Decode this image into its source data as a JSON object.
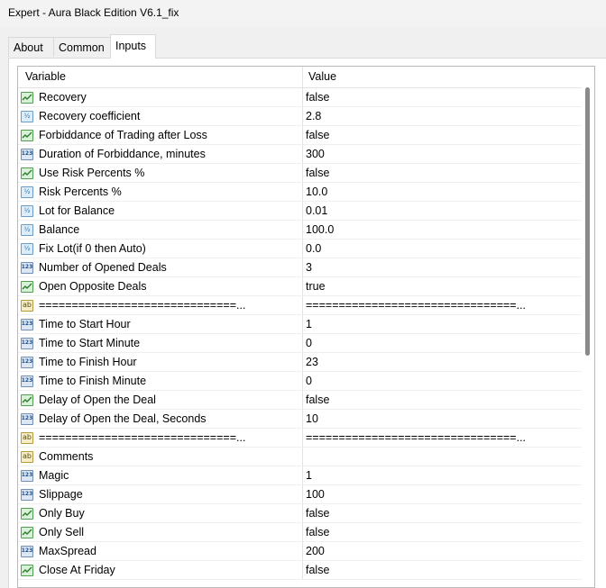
{
  "window": {
    "title": "Expert - Aura Black Edition V6.1_fix"
  },
  "tabs": [
    {
      "label": "About"
    },
    {
      "label": "Common"
    },
    {
      "label": "Inputs",
      "active": true
    }
  ],
  "table": {
    "columns": {
      "variable": "Variable",
      "value": "Value"
    },
    "rows": [
      {
        "type": "bool",
        "icon": "bool-icon",
        "name": "Recovery",
        "value": "false"
      },
      {
        "type": "dbl",
        "icon": "double-icon",
        "name": "Recovery coefficient",
        "value": "2.8"
      },
      {
        "type": "bool",
        "icon": "bool-icon",
        "name": "Forbiddance of Trading after Loss",
        "value": "false"
      },
      {
        "type": "int",
        "icon": "int-icon",
        "name": "Duration of Forbiddance, minutes",
        "value": "300"
      },
      {
        "type": "bool",
        "icon": "bool-icon",
        "name": "Use Risk Percents %",
        "value": "false"
      },
      {
        "type": "dbl",
        "icon": "double-icon",
        "name": "Risk Percents %",
        "value": "10.0"
      },
      {
        "type": "dbl",
        "icon": "double-icon",
        "name": "Lot for Balance",
        "value": "0.01"
      },
      {
        "type": "dbl",
        "icon": "double-icon",
        "name": "Balance",
        "value": "100.0"
      },
      {
        "type": "dbl",
        "icon": "double-icon",
        "name": "Fix Lot(if 0 then Auto)",
        "value": "0.0"
      },
      {
        "type": "int",
        "icon": "int-icon",
        "name": "Number of Opened Deals",
        "value": "3"
      },
      {
        "type": "bool",
        "icon": "bool-icon",
        "name": "Open Opposite Deals",
        "value": "true"
      },
      {
        "type": "str",
        "icon": "string-icon",
        "name": "==============================...",
        "value": "================================..."
      },
      {
        "type": "int",
        "icon": "int-icon",
        "name": "Time to Start Hour",
        "value": "1"
      },
      {
        "type": "int",
        "icon": "int-icon",
        "name": "Time to Start Minute",
        "value": "0"
      },
      {
        "type": "int",
        "icon": "int-icon",
        "name": "Time to Finish Hour",
        "value": "23"
      },
      {
        "type": "int",
        "icon": "int-icon",
        "name": "Time to Finish Minute",
        "value": "0"
      },
      {
        "type": "bool",
        "icon": "bool-icon",
        "name": "Delay of Open the Deal",
        "value": "false"
      },
      {
        "type": "int",
        "icon": "int-icon",
        "name": "Delay of Open the Deal, Seconds",
        "value": "10"
      },
      {
        "type": "str",
        "icon": "string-icon",
        "name": "==============================...",
        "value": "================================..."
      },
      {
        "type": "str",
        "icon": "string-icon",
        "name": "Comments",
        "value": ""
      },
      {
        "type": "int",
        "icon": "int-icon",
        "name": "Magic",
        "value": "1"
      },
      {
        "type": "int",
        "icon": "int-icon",
        "name": "Slippage",
        "value": "100"
      },
      {
        "type": "bool",
        "icon": "bool-icon",
        "name": "Only Buy",
        "value": "false"
      },
      {
        "type": "bool",
        "icon": "bool-icon",
        "name": "Only Sell",
        "value": "false"
      },
      {
        "type": "int",
        "icon": "int-icon",
        "name": "MaxSpread",
        "value": "200"
      },
      {
        "type": "bool",
        "icon": "bool-icon",
        "name": "Close At Friday",
        "value": "false"
      }
    ]
  }
}
